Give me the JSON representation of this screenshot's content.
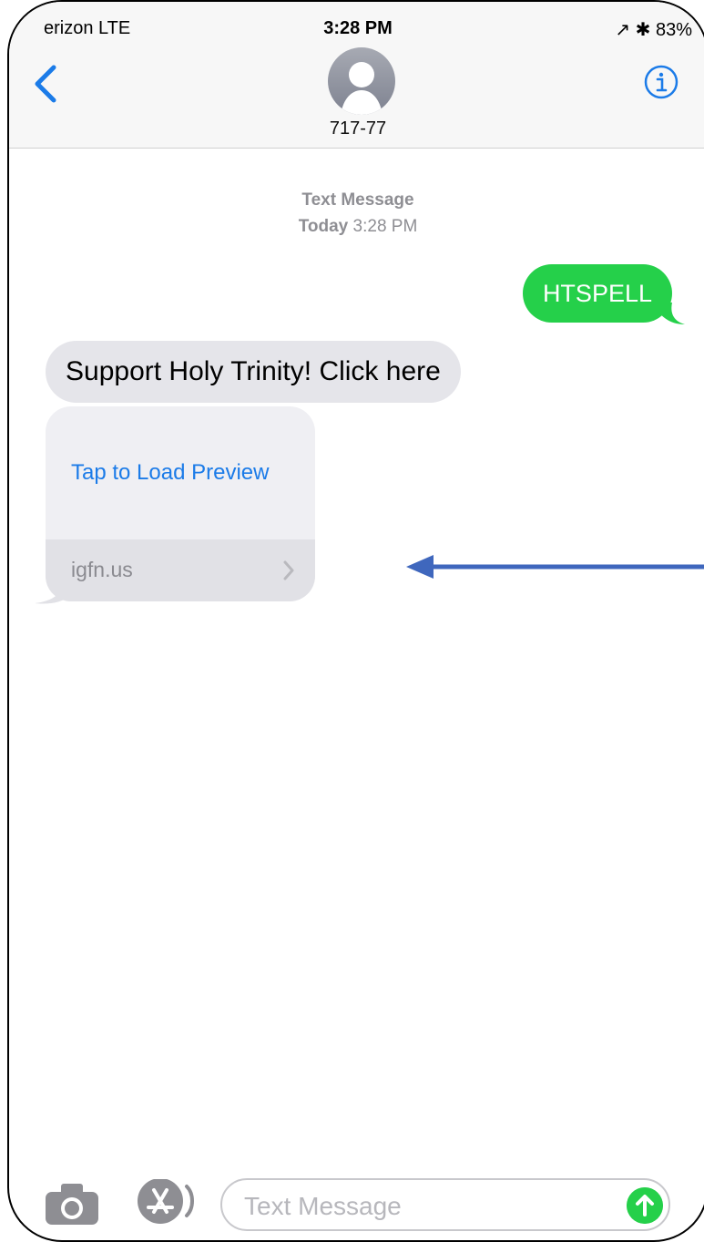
{
  "status_bar": {
    "carrier": "erizon  LTE",
    "time": "3:28 PM",
    "right": "↗ ✱ 83%"
  },
  "header": {
    "contact": "717-77",
    "back_icon": "chevron-left-icon",
    "info_icon": "info-icon",
    "accent": "#1b7be8"
  },
  "conversation": {
    "service": "Text Message",
    "day": "Today",
    "time": "3:28 PM",
    "outgoing": "HTSPELL",
    "incoming": "Support Holy Trinity! Click here",
    "preview": {
      "action": "Tap to Load Preview",
      "domain": "igfn.us"
    }
  },
  "composer": {
    "placeholder": "Text Message",
    "camera_icon": "camera-icon",
    "apps_icon": "app-store-icon",
    "send_icon": "send-arrow-icon"
  },
  "colors": {
    "outgoing_bubble": "#25d04a",
    "incoming_bubble": "#e5e5ea",
    "annotation_arrow": "#3f67bd"
  }
}
